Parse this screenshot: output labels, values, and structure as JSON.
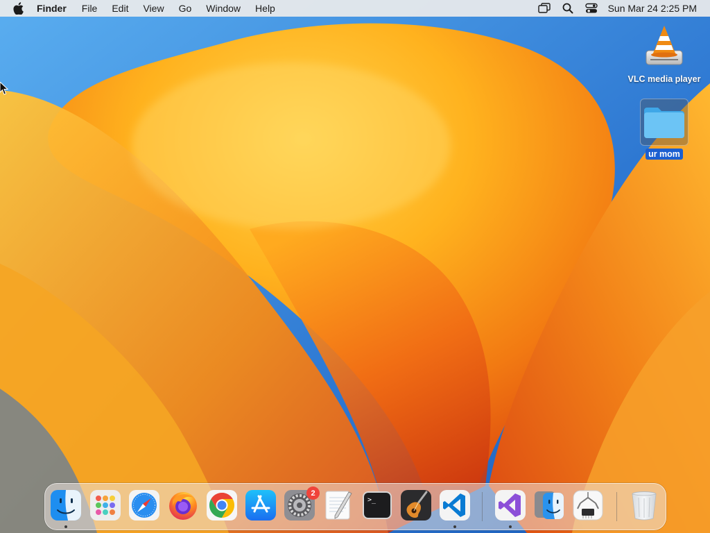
{
  "menubar": {
    "apple_icon": "apple-logo-icon",
    "app_name": "Finder",
    "menus": [
      "File",
      "Edit",
      "View",
      "Go",
      "Window",
      "Help"
    ],
    "status_icons": [
      "screen-mirroring-icon",
      "spotlight-search-icon",
      "control-center-icon"
    ],
    "clock": "Sun Mar 24  2:25 PM"
  },
  "desktop": {
    "icons": [
      {
        "label": "VLC media player",
        "icon": "vlc-cone-icon",
        "selected": false
      },
      {
        "label": "ur mom",
        "icon": "folder-icon",
        "selected": true
      }
    ]
  },
  "dock": {
    "apps": [
      {
        "name": "Finder",
        "icon": "finder-icon",
        "running": true
      },
      {
        "name": "Launchpad",
        "icon": "launchpad-icon",
        "running": false
      },
      {
        "name": "Safari",
        "icon": "safari-icon",
        "running": false
      },
      {
        "name": "Firefox",
        "icon": "firefox-icon",
        "running": false
      },
      {
        "name": "Google Chrome",
        "icon": "chrome-icon",
        "running": false
      },
      {
        "name": "App Store",
        "icon": "app-store-icon",
        "running": false
      },
      {
        "name": "System Settings",
        "icon": "system-settings-icon",
        "running": false,
        "badge": "2"
      },
      {
        "name": "TextEdit",
        "icon": "textedit-icon",
        "running": false
      },
      {
        "name": "Terminal",
        "icon": "terminal-icon",
        "running": false
      },
      {
        "name": "GarageBand",
        "icon": "garageband-icon",
        "running": false
      },
      {
        "name": "Visual Studio Code",
        "icon": "vscode-icon",
        "running": true
      },
      {
        "name": "Visual Studio",
        "icon": "visual-studio-icon",
        "running": true
      },
      {
        "name": "Migration Assistant",
        "icon": "migration-assistant-icon",
        "running": false
      },
      {
        "name": "System Information",
        "icon": "system-information-icon",
        "running": false
      },
      {
        "name": "Trash",
        "icon": "trash-icon",
        "running": false
      }
    ],
    "terminal_prompt": ">_"
  },
  "colors": {
    "menubar_bg": "#ececec",
    "selection_blue": "#1b5fd1",
    "badge_red": "#f0433a",
    "wallpaper_blue": "#2f7fd6",
    "wallpaper_orange": "#f7a21a"
  }
}
